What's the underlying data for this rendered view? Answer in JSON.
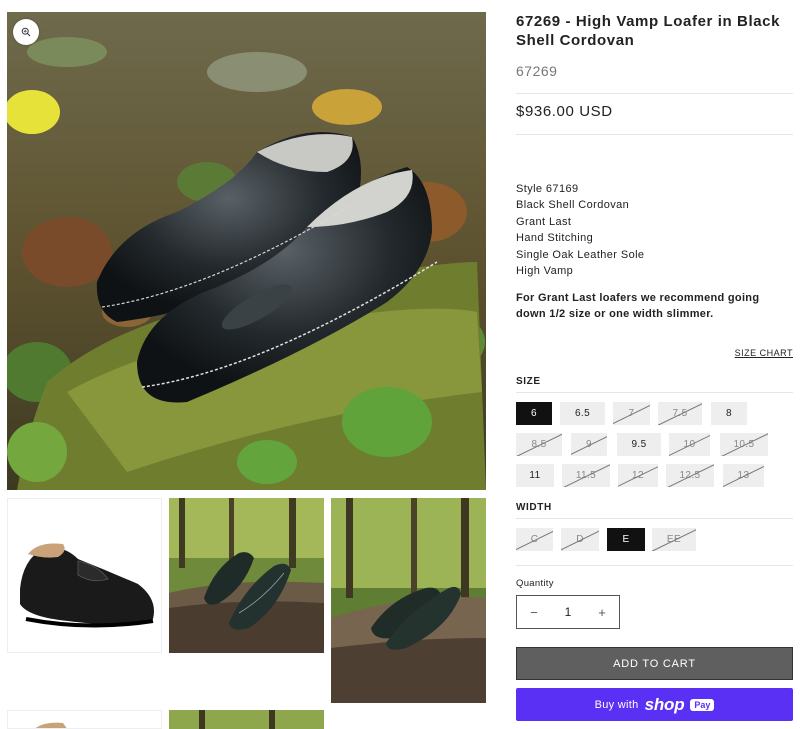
{
  "product": {
    "title": "67269 - High Vamp Loafer in Black Shell Cordovan",
    "sku": "67269",
    "price": "$936.00 USD",
    "description": [
      "Style 67169",
      "Black Shell Cordovan",
      "Grant Last",
      "Hand Stitching",
      "Single Oak Leather Sole",
      "High Vamp"
    ],
    "fit_note": "For Grant Last loafers we recommend going down 1/2 size or one width slimmer.",
    "size_chart_label": "SIZE CHART"
  },
  "options": {
    "size_label": "SIZE",
    "sizes": [
      {
        "label": "6",
        "state": "selected"
      },
      {
        "label": "6.5",
        "state": "available"
      },
      {
        "label": "7",
        "state": "unavailable"
      },
      {
        "label": "7.5",
        "state": "unavailable"
      },
      {
        "label": "8",
        "state": "available"
      },
      {
        "label": "8.5",
        "state": "unavailable"
      },
      {
        "label": "9",
        "state": "unavailable"
      },
      {
        "label": "9.5",
        "state": "available"
      },
      {
        "label": "10",
        "state": "unavailable"
      },
      {
        "label": "10.5",
        "state": "unavailable"
      },
      {
        "label": "11",
        "state": "available"
      },
      {
        "label": "11.5",
        "state": "unavailable"
      },
      {
        "label": "12",
        "state": "unavailable"
      },
      {
        "label": "12.5",
        "state": "unavailable"
      },
      {
        "label": "13",
        "state": "unavailable"
      }
    ],
    "width_label": "WIDTH",
    "widths": [
      {
        "label": "C",
        "state": "unavailable"
      },
      {
        "label": "D",
        "state": "unavailable"
      },
      {
        "label": "E",
        "state": "selected"
      },
      {
        "label": "EE",
        "state": "unavailable"
      }
    ]
  },
  "quantity": {
    "label": "Quantity",
    "value": "1",
    "minus": "−",
    "plus": "+"
  },
  "buttons": {
    "add_to_cart": "ADD TO CART",
    "buy_with": "Buy with",
    "shop": "shop",
    "pay": "Pay"
  },
  "colors": {
    "accent": "#5a31f4",
    "selected": "#111111",
    "chip_bg": "#eeeeee"
  }
}
